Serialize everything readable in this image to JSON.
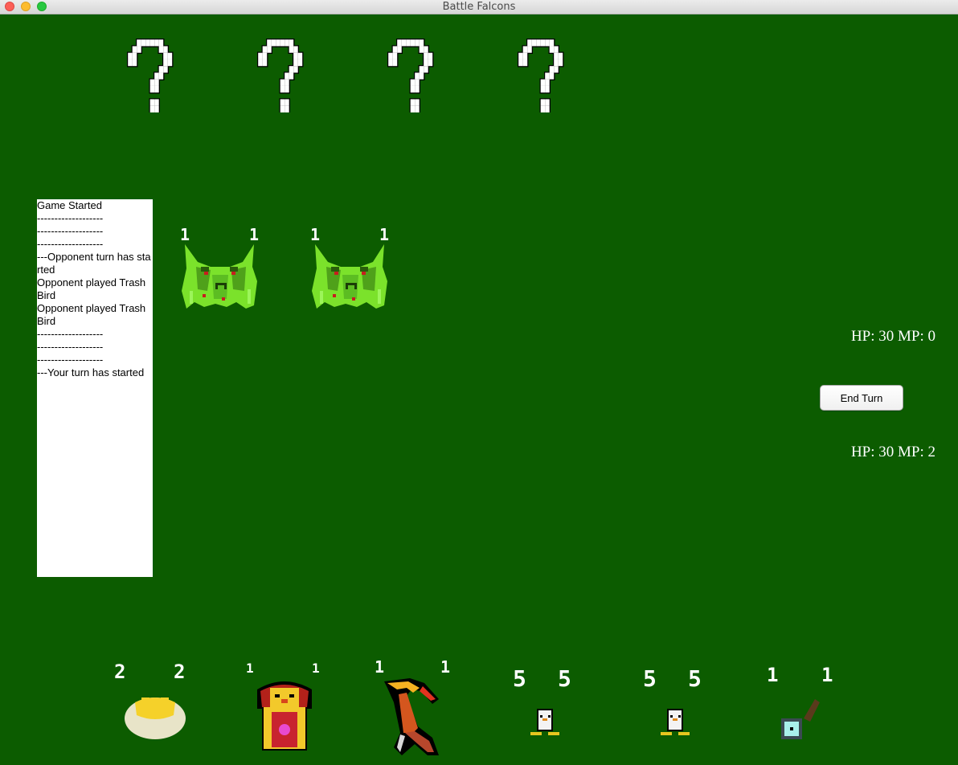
{
  "window": {
    "title": "Battle Falcons"
  },
  "opponent_hand": {
    "hidden_card_symbol": "?",
    "count": 4
  },
  "game_log": {
    "lines": [
      "Game Started",
      "-------------------",
      "-------------------",
      "-------------------",
      "---Opponent turn has started",
      "Opponent played Trash Bird",
      "Opponent played Trash Bird",
      "-------------------",
      "-------------------",
      "-------------------",
      "---Your turn has started"
    ]
  },
  "opponent_board": {
    "minions": [
      {
        "name": "Trash Bird",
        "attack": "1",
        "health": "1"
      },
      {
        "name": "Trash Bird",
        "attack": "1",
        "health": "1"
      }
    ]
  },
  "opponent_status": {
    "text": "HP: 30 MP: 0"
  },
  "end_turn": {
    "label": "End Turn"
  },
  "player_status": {
    "text": "HP: 30 MP: 2"
  },
  "player_hand": {
    "cards": [
      {
        "icon": "egg-icon",
        "cost": "2",
        "power": "2"
      },
      {
        "icon": "queen-bird-icon",
        "cost": "1",
        "power": "1"
      },
      {
        "icon": "talon-claw-icon",
        "cost": "1",
        "power": "1"
      },
      {
        "icon": "chick-icon",
        "cost": "5",
        "power": "5"
      },
      {
        "icon": "chick-icon",
        "cost": "5",
        "power": "5"
      },
      {
        "icon": "fishing-rod-icon",
        "cost": "1",
        "power": "1"
      }
    ]
  },
  "colors": {
    "board": "#0c5c00",
    "trash_bird": "#7be22b",
    "egg": "#f5d12a"
  }
}
